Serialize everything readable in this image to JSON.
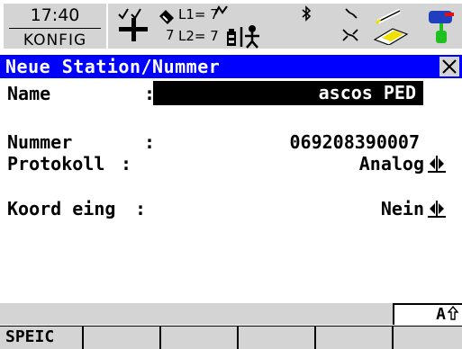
{
  "statusbar": {
    "time": "17:40",
    "mode": "KONFIG",
    "l1": "L1= 7",
    "l2": "L2= 7",
    "sat_count": "7"
  },
  "dialog": {
    "title": "Neue Station/Nummer"
  },
  "form": {
    "name": {
      "label": "Name",
      "value": "ascos PED"
    },
    "nummer": {
      "label": "Nummer",
      "value": "069208390007"
    },
    "protokoll": {
      "label": "Protokoll",
      "value": "Analog"
    },
    "koord": {
      "label": "Koord eing",
      "value": "Nein"
    }
  },
  "shift": "A",
  "fkeys": [
    "SPEIC",
    "",
    "",
    "",
    "",
    ""
  ],
  "colors": {
    "title_bg": "#0000ff",
    "panel_gray": "#d4d4d4"
  }
}
